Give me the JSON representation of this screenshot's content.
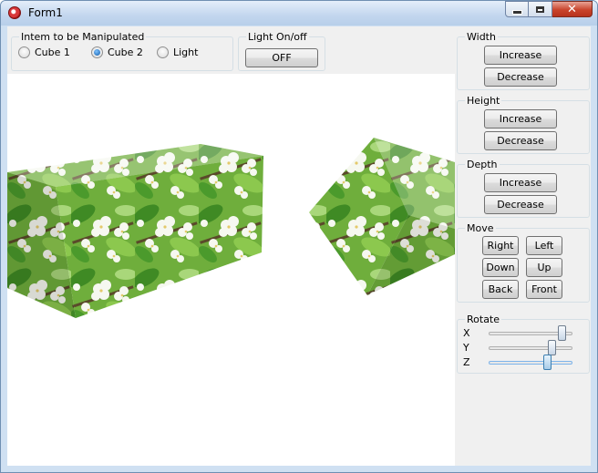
{
  "window": {
    "title": "Form1"
  },
  "manipulate_group": {
    "title": "Intem to be Manipulated",
    "options": [
      {
        "label": "Cube 1",
        "selected": false
      },
      {
        "label": "Cube 2",
        "selected": true
      },
      {
        "label": "Light",
        "selected": false
      }
    ]
  },
  "light_group": {
    "title": "Light On/off",
    "button_label": "OFF"
  },
  "width_group": {
    "title": "Width",
    "increase_label": "Increase",
    "decrease_label": "Decrease"
  },
  "height_group": {
    "title": "Height",
    "increase_label": "Increase",
    "decrease_label": "Decrease"
  },
  "depth_group": {
    "title": "Depth",
    "increase_label": "Increase",
    "decrease_label": "Decrease"
  },
  "move_group": {
    "title": "Move",
    "right_label": "Right",
    "left_label": "Left",
    "down_label": "Down",
    "up_label": "Up",
    "back_label": "Back",
    "front_label": "Front"
  },
  "rotate_group": {
    "title": "Rotate",
    "sliders": [
      {
        "axis": "X",
        "value": 0.92
      },
      {
        "axis": "Y",
        "value": 0.78
      },
      {
        "axis": "Z",
        "value": 0.72
      }
    ]
  },
  "colors": {
    "accent": "#3c7fb1",
    "leaf_green": "#4e9a2e",
    "blossom": "#f4f7ee"
  }
}
